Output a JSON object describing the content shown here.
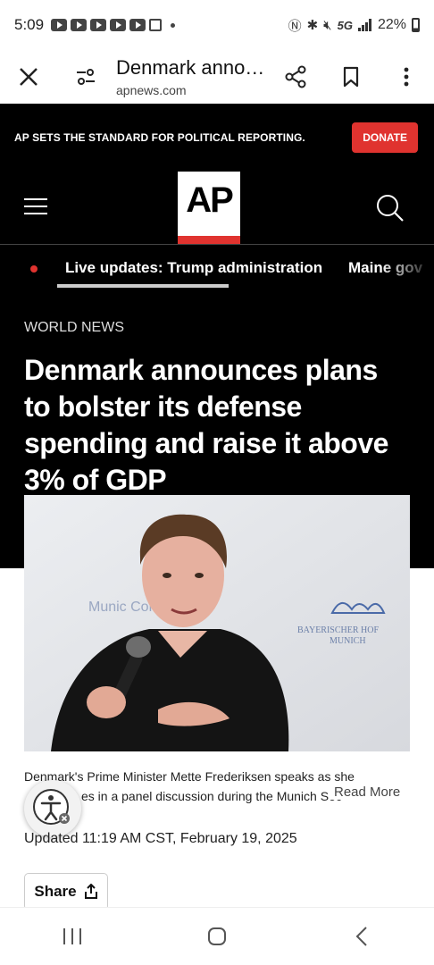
{
  "status_bar": {
    "time": "5:09",
    "network": "5G",
    "battery": "22%"
  },
  "browser": {
    "title": "Denmark anno…",
    "url": "apnews.com"
  },
  "header": {
    "promo_text": "AP SETS THE STANDARD FOR POLITICAL REPORTING.",
    "donate_label": "DONATE",
    "logo_text": "AP",
    "accent_color": "#e0332f"
  },
  "ticker": {
    "items": [
      "Live updates: Trump administration",
      "Maine gov"
    ]
  },
  "article": {
    "section": "WORLD NEWS",
    "headline": "Denmark announces plans to bolster its defense spending and raise it above 3% of GDP",
    "photo_text_left": "Munic Confer",
    "photo_text_right_1": "BAYERISCHER HOF",
    "photo_text_right_2": "MUNICH",
    "caption_line1": "Denmark's Prime Minister Mette Frederiksen speaks as she",
    "caption_line2": "es in a panel discussion during the Munich Sec",
    "read_more": "Read More",
    "updated": "Updated 11:19 AM CST, February 19, 2025",
    "share_label": "Share"
  }
}
